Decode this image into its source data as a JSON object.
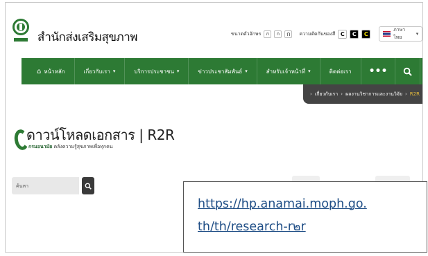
{
  "header": {
    "site_title": "สำนักส่งเสริมสุขภาพ",
    "font_size_label": "ขนาดตัวอักษร",
    "font_sizes": [
      "ก",
      "ก",
      "ก"
    ],
    "contrast_label": "ความตัดกันของสี",
    "contrast": [
      "C",
      "C",
      "C"
    ],
    "language": "ภาษาไทย"
  },
  "nav": {
    "items": [
      {
        "label": "หน้าหลัก",
        "icon": "home-icon"
      },
      {
        "label": "เกี่ยวกับเรา",
        "dropdown": true
      },
      {
        "label": "บริการประชาชน",
        "dropdown": true
      },
      {
        "label": "ข่าวประชาสัมพันธ์",
        "dropdown": true
      },
      {
        "label": "สำหรับเจ้าหน้าที่",
        "dropdown": true
      },
      {
        "label": "ติดต่อเรา"
      }
    ],
    "more": "•••",
    "search_icon": "search-icon",
    "sitemap_icon": "sitemap-icon"
  },
  "breadcrumb": [
    "เกี่ยวกับเรา",
    "ผลงานวิชาการและงานวิจัย",
    "R2R"
  ],
  "page": {
    "title": "ดาวน์โหลดเอกสาร | R2R",
    "subtitle_bold": "กรมอนามัย",
    "subtitle": "คลังความรู้สุขภาพเพื่อทุกคน"
  },
  "search": {
    "placeholder": "ค้นหา"
  },
  "overlay": {
    "line1": "https://hp.anamai.moph.go.",
    "line2": "th/th/research-r๒r"
  },
  "colors": {
    "nav_bg": "#2d7a34",
    "breadcrumb_bg": "#444444",
    "link": "#1f4e86"
  }
}
